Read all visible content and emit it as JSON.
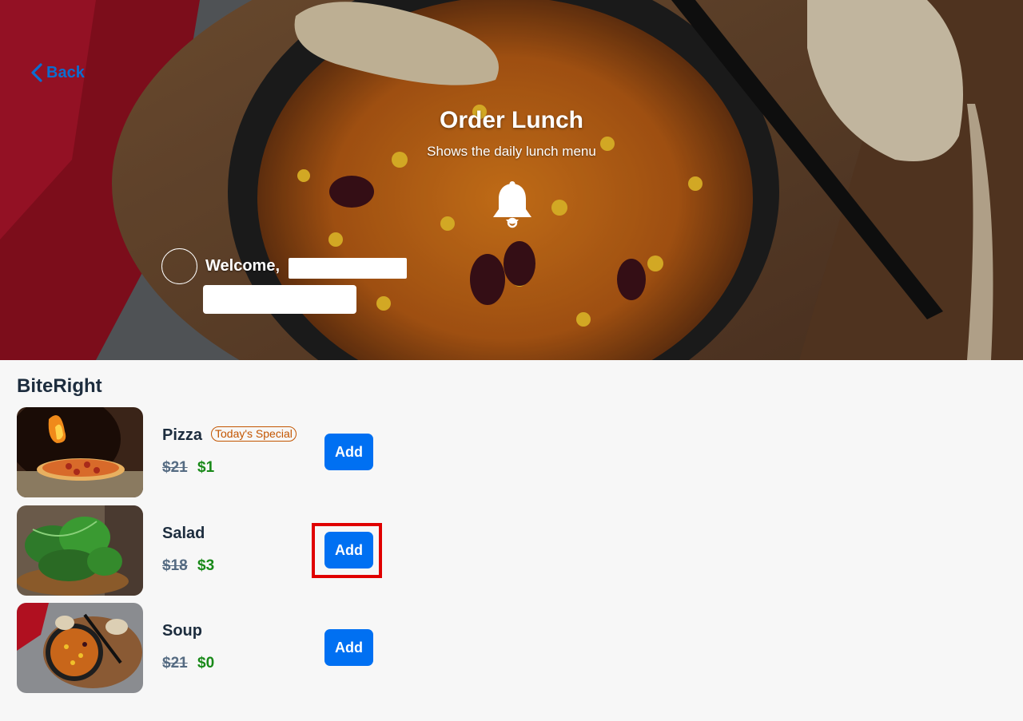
{
  "header": {
    "back_label": "Back",
    "title": "Order Lunch",
    "subtitle": "Shows the daily lunch menu",
    "welcome_label": "Welcome,"
  },
  "vendor": {
    "name": "BiteRight"
  },
  "menu": {
    "items": [
      {
        "name": "Pizza",
        "badge": "Today's Special",
        "old_price": "$21",
        "new_price": "$1",
        "add_label": "Add"
      },
      {
        "name": "Salad",
        "badge": "",
        "old_price": "$18",
        "new_price": "$3",
        "add_label": "Add"
      },
      {
        "name": "Soup",
        "badge": "",
        "old_price": "$21",
        "new_price": "$0",
        "add_label": "Add"
      }
    ]
  },
  "colors": {
    "accent": "#0070f2",
    "back_link": "#0a6ed1",
    "discount_price": "#188918",
    "original_price": "#556b82",
    "badge": "#c35500",
    "highlight": "#e00000"
  },
  "icons": {
    "back": "chevron-left-icon",
    "notification": "bell-icon"
  }
}
